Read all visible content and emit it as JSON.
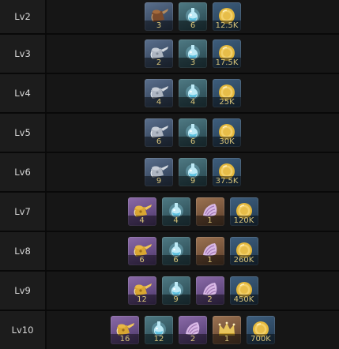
{
  "rows": [
    {
      "level": "Lv2",
      "items": [
        {
          "icon": "brown-can-icon",
          "rarity": "blue",
          "count": "3"
        },
        {
          "icon": "essence-flask-icon",
          "rarity": "teal",
          "count": "6"
        },
        {
          "icon": "gold-coin-icon",
          "rarity": "gold",
          "count": "12.5K"
        }
      ]
    },
    {
      "level": "Lv3",
      "items": [
        {
          "icon": "silver-can-icon",
          "rarity": "blue",
          "count": "2"
        },
        {
          "icon": "essence-flask-icon",
          "rarity": "teal",
          "count": "3"
        },
        {
          "icon": "gold-coin-icon",
          "rarity": "gold",
          "count": "17.5K"
        }
      ]
    },
    {
      "level": "Lv4",
      "items": [
        {
          "icon": "silver-can-icon",
          "rarity": "blue",
          "count": "4"
        },
        {
          "icon": "essence-flask-icon",
          "rarity": "teal",
          "count": "4"
        },
        {
          "icon": "gold-coin-icon",
          "rarity": "gold",
          "count": "25K"
        }
      ]
    },
    {
      "level": "Lv5",
      "items": [
        {
          "icon": "silver-can-icon",
          "rarity": "blue",
          "count": "6"
        },
        {
          "icon": "essence-flask-icon",
          "rarity": "teal",
          "count": "6"
        },
        {
          "icon": "gold-coin-icon",
          "rarity": "gold",
          "count": "30K"
        }
      ]
    },
    {
      "level": "Lv6",
      "items": [
        {
          "icon": "silver-can-icon",
          "rarity": "blue",
          "count": "9"
        },
        {
          "icon": "essence-flask-icon",
          "rarity": "teal",
          "count": "9"
        },
        {
          "icon": "gold-coin-icon",
          "rarity": "gold",
          "count": "37.5K"
        }
      ]
    },
    {
      "level": "Lv7",
      "items": [
        {
          "icon": "golden-can-icon",
          "rarity": "purple",
          "count": "4"
        },
        {
          "icon": "essence-flask-icon",
          "rarity": "teal",
          "count": "4"
        },
        {
          "icon": "spiral-shell-icon",
          "rarity": "orange",
          "count": "1"
        },
        {
          "icon": "gold-coin-icon",
          "rarity": "gold",
          "count": "120K"
        }
      ]
    },
    {
      "level": "Lv8",
      "items": [
        {
          "icon": "golden-can-icon",
          "rarity": "purple",
          "count": "6"
        },
        {
          "icon": "essence-flask-icon",
          "rarity": "teal",
          "count": "6"
        },
        {
          "icon": "spiral-shell-icon",
          "rarity": "orange",
          "count": "1"
        },
        {
          "icon": "gold-coin-icon",
          "rarity": "gold",
          "count": "260K"
        }
      ]
    },
    {
      "level": "Lv9",
      "items": [
        {
          "icon": "golden-can-icon",
          "rarity": "purple",
          "count": "12"
        },
        {
          "icon": "essence-flask-icon",
          "rarity": "teal",
          "count": "9"
        },
        {
          "icon": "spiral-shell-icon",
          "rarity": "purple",
          "count": "2"
        },
        {
          "icon": "gold-coin-icon",
          "rarity": "gold",
          "count": "450K"
        }
      ]
    },
    {
      "level": "Lv10",
      "items": [
        {
          "icon": "golden-can-icon",
          "rarity": "purple",
          "count": "16"
        },
        {
          "icon": "essence-flask-icon",
          "rarity": "teal",
          "count": "12"
        },
        {
          "icon": "spiral-shell-icon",
          "rarity": "purple",
          "count": "2"
        },
        {
          "icon": "golden-crown-icon",
          "rarity": "orange",
          "count": "1"
        },
        {
          "icon": "gold-coin-icon",
          "rarity": "gold",
          "count": "700K"
        }
      ]
    }
  ]
}
